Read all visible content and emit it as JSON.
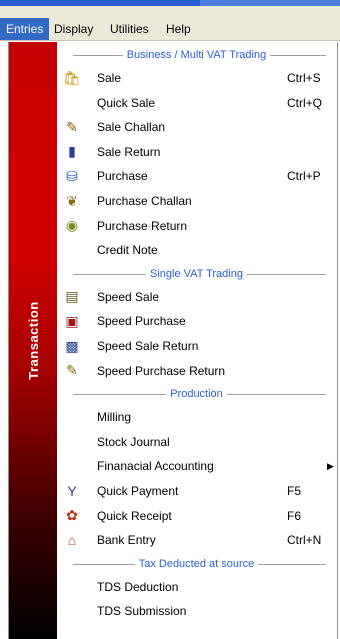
{
  "menubar": {
    "items": [
      "Entries",
      "Display",
      "Utilities",
      "Help"
    ]
  },
  "sidebar": {
    "label": "Transaction"
  },
  "sections": [
    {
      "header": "Business / Multi VAT Trading",
      "items": [
        {
          "label": "Sale",
          "shortcut": "Ctrl+S",
          "icon": "sale-icon"
        },
        {
          "label": "Quick Sale",
          "shortcut": "Ctrl+Q",
          "icon": ""
        },
        {
          "label": "Sale Challan",
          "shortcut": "",
          "icon": "sale-challan-icon"
        },
        {
          "label": "Sale Return",
          "shortcut": "",
          "icon": "sale-return-icon"
        },
        {
          "label": "Purchase",
          "shortcut": "Ctrl+P",
          "icon": "purchase-icon"
        },
        {
          "label": "Purchase Challan",
          "shortcut": "",
          "icon": "purchase-challan-icon"
        },
        {
          "label": "Purchase Return",
          "shortcut": "",
          "icon": "purchase-return-icon"
        },
        {
          "label": "Credit Note",
          "shortcut": "",
          "icon": ""
        }
      ]
    },
    {
      "header": "Single VAT Trading",
      "items": [
        {
          "label": "Speed Sale",
          "shortcut": "",
          "icon": "speed-sale-icon"
        },
        {
          "label": "Speed Purchase",
          "shortcut": "",
          "icon": "speed-purchase-icon"
        },
        {
          "label": "Speed Sale Return",
          "shortcut": "",
          "icon": "speed-sale-return-icon"
        },
        {
          "label": "Speed Purchase Return",
          "shortcut": "",
          "icon": "speed-purchase-return-icon"
        }
      ]
    },
    {
      "header": "Production",
      "items": [
        {
          "label": "Milling",
          "shortcut": "",
          "icon": ""
        },
        {
          "label": "Stock Journal",
          "shortcut": "",
          "icon": ""
        },
        {
          "label": "Finanacial Accounting",
          "shortcut": "",
          "icon": "",
          "submenu": true
        },
        {
          "label": "Quick Payment",
          "shortcut": "F5",
          "icon": "quick-payment-icon"
        },
        {
          "label": "Quick Receipt",
          "shortcut": "F6",
          "icon": "quick-receipt-icon"
        },
        {
          "label": "Bank Entry",
          "shortcut": "Ctrl+N",
          "icon": "bank-entry-icon"
        }
      ]
    },
    {
      "header": "Tax Deducted at source",
      "items": [
        {
          "label": "TDS Deduction",
          "shortcut": "",
          "icon": ""
        },
        {
          "label": "TDS Submission",
          "shortcut": "",
          "icon": ""
        }
      ]
    }
  ],
  "colors": {
    "menu_highlight": "#316ac5",
    "section_header": "#2a5fd3",
    "sidebar_top": "#c40000",
    "sidebar_bottom": "#000000"
  }
}
